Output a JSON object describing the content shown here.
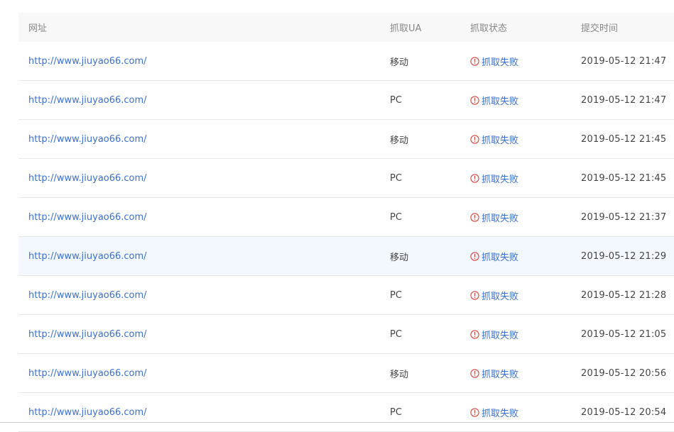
{
  "table": {
    "headers": {
      "url": "网址",
      "ua": "抓取UA",
      "status": "抓取状态",
      "time": "提交时间"
    },
    "rows": [
      {
        "url": "http://www.jiuyao66.com/",
        "ua": "移动",
        "status": "抓取失败",
        "time": "2019-05-12 21:47"
      },
      {
        "url": "http://www.jiuyao66.com/",
        "ua": "PC",
        "status": "抓取失败",
        "time": "2019-05-12 21:47"
      },
      {
        "url": "http://www.jiuyao66.com/",
        "ua": "移动",
        "status": "抓取失败",
        "time": "2019-05-12 21:45"
      },
      {
        "url": "http://www.jiuyao66.com/",
        "ua": "PC",
        "status": "抓取失败",
        "time": "2019-05-12 21:45"
      },
      {
        "url": "http://www.jiuyao66.com/",
        "ua": "PC",
        "status": "抓取失败",
        "time": "2019-05-12 21:37"
      },
      {
        "url": "http://www.jiuyao66.com/",
        "ua": "移动",
        "status": "抓取失败",
        "time": "2019-05-12 21:29"
      },
      {
        "url": "http://www.jiuyao66.com/",
        "ua": "PC",
        "status": "抓取失败",
        "time": "2019-05-12 21:28"
      },
      {
        "url": "http://www.jiuyao66.com/",
        "ua": "PC",
        "status": "抓取失败",
        "time": "2019-05-12 21:05"
      },
      {
        "url": "http://www.jiuyao66.com/",
        "ua": "移动",
        "status": "抓取失败",
        "time": "2019-05-12 20:56"
      },
      {
        "url": "http://www.jiuyao66.com/",
        "ua": "PC",
        "status": "抓取失败",
        "time": "2019-05-12 20:54"
      }
    ],
    "highlighted_row": 6
  },
  "colors": {
    "link": "#3a6fd8",
    "error_icon": "#e0433a",
    "header_bg": "#f8f8f8",
    "highlight_bg": "#f3f7fe"
  },
  "icons": {
    "status": "exclamation-circle-icon"
  }
}
